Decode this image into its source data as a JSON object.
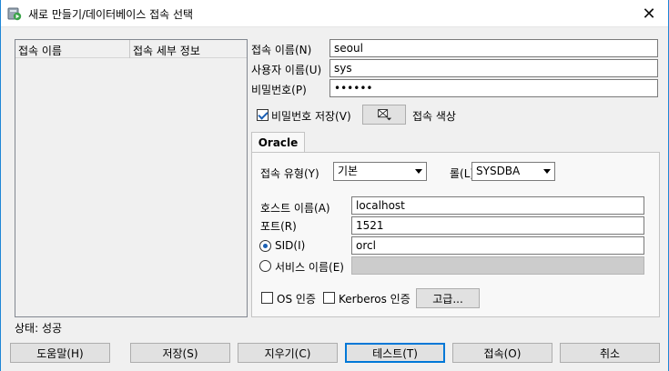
{
  "window": {
    "title": "새로 만들기/데이터베이스 접속 선택"
  },
  "connection_list": {
    "columns": [
      "접속 이름",
      "접속 세부 정보"
    ]
  },
  "form": {
    "name_label": "접속 이름(N)",
    "name_value": "seoul",
    "user_label": "사용자 이름(U)",
    "user_value": "sys",
    "password_label": "비밀번호(P)",
    "password_value": "••••••",
    "save_password_label": "비밀번호 저장(V)",
    "save_password_checked": true,
    "connection_color_label": "접속 색상"
  },
  "tab": {
    "label": "Oracle",
    "conn_type_label": "접속 유형(Y)",
    "conn_type_value": "기본",
    "role_label": "롤(L)",
    "role_value": "SYSDBA",
    "host_label": "호스트 이름(A)",
    "host_value": "localhost",
    "port_label": "포트(R)",
    "port_value": "1521",
    "sid_label": "SID(I)",
    "sid_value": "orcl",
    "service_label": "서비스 이름(E)",
    "service_value": "",
    "os_auth_label": "OS 인증",
    "kerberos_label": "Kerberos 인증",
    "advanced_label": "고급..."
  },
  "status": {
    "text": "상태: 성공"
  },
  "buttons": {
    "help": "도움말(H)",
    "save": "저장(S)",
    "clear": "지우기(C)",
    "test": "테스트(T)",
    "connect": "접속(O)",
    "cancel": "취소"
  },
  "icons": {
    "app": "sql-developer-icon",
    "close": "close-icon",
    "color": "color-picker-icon"
  }
}
